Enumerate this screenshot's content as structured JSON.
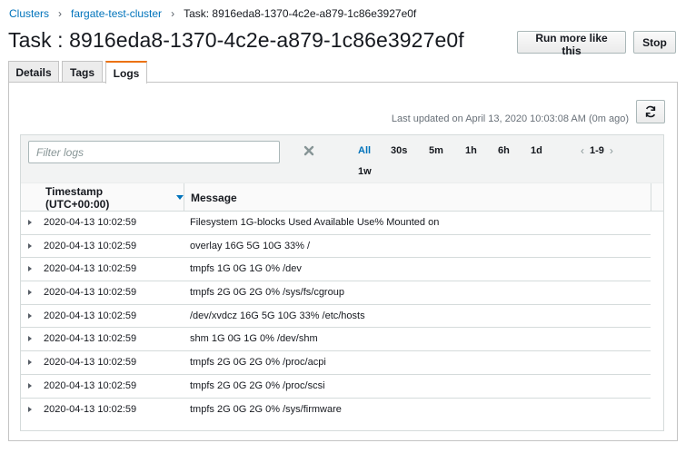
{
  "breadcrumb": {
    "clusters": "Clusters",
    "cluster": "fargate-test-cluster",
    "current": "Task: 8916eda8-1370-4c2e-a879-1c86e3927e0f",
    "separator": "›"
  },
  "page": {
    "title": "Task : 8916eda8-1370-4c2e-a879-1c86e3927e0f",
    "run_more_label": "Run more like this",
    "stop_label": "Stop"
  },
  "tabs": [
    {
      "label": "Details"
    },
    {
      "label": "Tags"
    },
    {
      "label": "Logs",
      "active": true
    }
  ],
  "logs": {
    "last_updated": "Last updated on April 13, 2020 10:03:08 AM (0m ago)",
    "filter_placeholder": "Filter logs",
    "ranges": [
      "All",
      "30s",
      "5m",
      "1h",
      "6h",
      "1d",
      "1w"
    ],
    "active_range": "All",
    "pager": "1-9",
    "columns": {
      "timestamp": "Timestamp (UTC+00:00)",
      "message": "Message"
    },
    "rows": [
      {
        "timestamp": "2020-04-13 10:02:59",
        "message": "Filesystem 1G-blocks Used Available Use% Mounted on"
      },
      {
        "timestamp": "2020-04-13 10:02:59",
        "message": "overlay 16G 5G 10G 33% /"
      },
      {
        "timestamp": "2020-04-13 10:02:59",
        "message": "tmpfs 1G 0G 1G 0% /dev"
      },
      {
        "timestamp": "2020-04-13 10:02:59",
        "message": "tmpfs 2G 0G 2G 0% /sys/fs/cgroup"
      },
      {
        "timestamp": "2020-04-13 10:02:59",
        "message": "/dev/xvdcz 16G 5G 10G 33% /etc/hosts"
      },
      {
        "timestamp": "2020-04-13 10:02:59",
        "message": "shm 1G 0G 1G 0% /dev/shm"
      },
      {
        "timestamp": "2020-04-13 10:02:59",
        "message": "tmpfs 2G 0G 2G 0% /proc/acpi"
      },
      {
        "timestamp": "2020-04-13 10:02:59",
        "message": "tmpfs 2G 0G 2G 0% /proc/scsi"
      },
      {
        "timestamp": "2020-04-13 10:02:59",
        "message": "tmpfs 2G 0G 2G 0% /sys/firmware"
      }
    ]
  },
  "icons": {
    "refresh": "refresh-icon",
    "clear": "close-icon",
    "sort": "sort-descending-icon",
    "expand": "caret-right-icon",
    "prev": "chevron-left-icon",
    "next": "chevron-right-icon"
  },
  "colors": {
    "link": "#0073bb",
    "active_tab": "#ec7211",
    "text": "#16191f"
  }
}
